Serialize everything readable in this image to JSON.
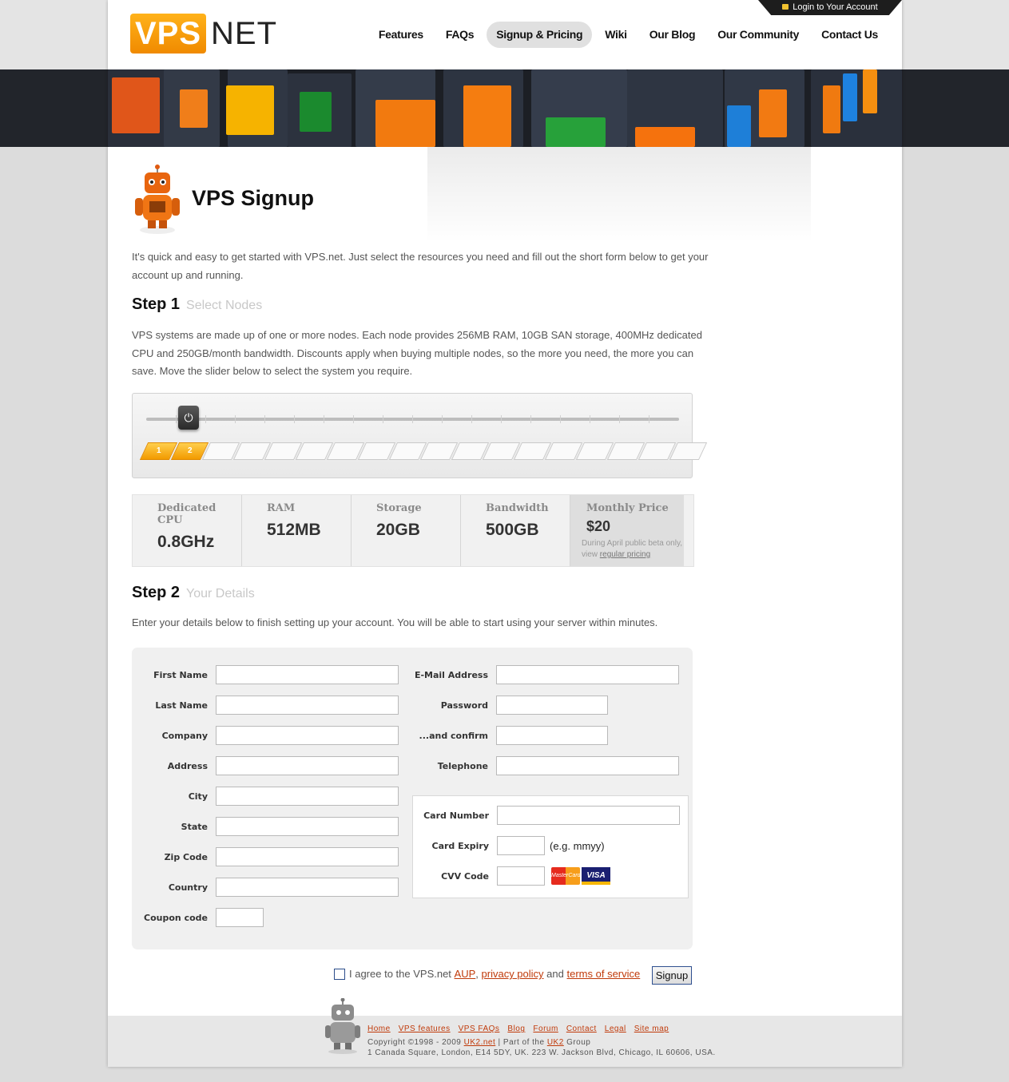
{
  "header": {
    "login_label": "Login to Your Account",
    "logo_left": "VPS",
    "logo_right": "NET",
    "nav": [
      "Features",
      "FAQs",
      "Signup & Pricing",
      "Wiki",
      "Our Blog",
      "Our Community",
      "Contact Us"
    ],
    "active_nav": "Signup & Pricing"
  },
  "page": {
    "title": "VPS Signup",
    "intro": "It's quick and easy to get started with VPS.net. Just select the resources you need and fill out the short form below to get your account up and running."
  },
  "step1": {
    "label": "Step 1",
    "sub": "Select Nodes",
    "desc": "VPS systems are made up of one or more nodes. Each node provides 256MB RAM, 10GB SAN storage, 400MHz dedicated CPU and 250GB/month bandwidth. Discounts apply when buying multiple nodes, so the more you need, the more you can save. Move the slider below to select the system you require.",
    "selected_nodes": 2,
    "total_nodes": 18,
    "node_labels": [
      "1",
      "2"
    ]
  },
  "specs": {
    "cpu_label": "Dedicated CPU",
    "cpu_value": "0.8GHz",
    "ram_label": "RAM",
    "ram_value": "512MB",
    "storage_label": "Storage",
    "storage_value": "20GB",
    "bandwidth_label": "Bandwidth",
    "bandwidth_value": "500GB",
    "price_label": "Monthly Price",
    "price_value": "$20",
    "price_note": "During April public beta only, view",
    "price_note_link": "regular pricing"
  },
  "step2": {
    "label": "Step 2",
    "sub": "Your Details",
    "desc": "Enter your details below to finish setting up your account. You will be able to start using your server within minutes."
  },
  "form": {
    "first_name": "First Name",
    "last_name": "Last Name",
    "company": "Company",
    "address": "Address",
    "city": "City",
    "state": "State",
    "zip": "Zip Code",
    "country": "Country",
    "coupon": "Coupon code",
    "email": "E-Mail Address",
    "password": "Password",
    "confirm": "...and confirm",
    "telephone": "Telephone",
    "card_number": "Card Number",
    "card_expiry": "Card Expiry",
    "expiry_hint": "(e.g. mmyy)",
    "cvv": "CVV Code",
    "mastercard": "MasterCard",
    "visa": "VISA"
  },
  "agree": {
    "prefix": "I agree to the VPS.net",
    "aup": "AUP",
    "privacy": "privacy policy",
    "and": "and",
    "terms": "terms of service",
    "button": "Signup"
  },
  "footer": {
    "links": [
      "Home",
      "VPS features",
      "VPS FAQs",
      "Blog",
      "Forum",
      "Contact",
      "Legal",
      "Site map"
    ],
    "copy_prefix": "Copyright ©1998 - 2009",
    "uk2net": "UK2.net",
    "part_of": "| Part of the",
    "uk2": "UK2",
    "group": "Group",
    "address": "1 Canada Square, London, E14 5DY, UK. 223 W. Jackson Blvd, Chicago, IL 60606, USA."
  }
}
